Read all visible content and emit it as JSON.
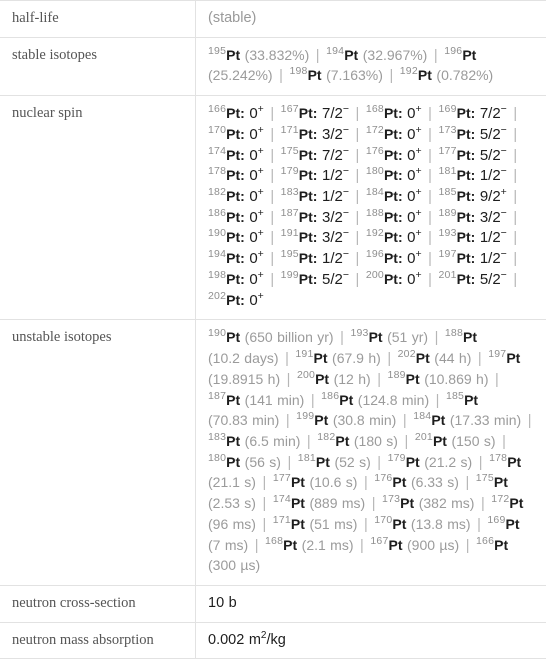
{
  "table": {
    "rows": [
      {
        "label": "half-life",
        "kind": "plain",
        "value": "(stable)"
      },
      {
        "label": "stable isotopes",
        "kind": "isotope_abundance"
      },
      {
        "label": "nuclear spin",
        "kind": "spin_list"
      },
      {
        "label": "unstable isotopes",
        "kind": "isotope_halflife"
      },
      {
        "label": "neutron cross-section",
        "kind": "plain_dark",
        "value": "10 b"
      },
      {
        "label": "neutron mass absorption",
        "kind": "units",
        "value_pre": "0.002 m",
        "value_sup": "2",
        "value_post": "/kg"
      }
    ]
  },
  "half_life": {
    "value": "(stable)"
  },
  "stable_isotopes": [
    {
      "mass": "195",
      "symbol": "Pt",
      "detail": "(33.832%)"
    },
    {
      "mass": "194",
      "symbol": "Pt",
      "detail": "(32.967%)"
    },
    {
      "mass": "196",
      "symbol": "Pt",
      "detail": "(25.242%)"
    },
    {
      "mass": "198",
      "symbol": "Pt",
      "detail": "(7.163%)"
    },
    {
      "mass": "192",
      "symbol": "Pt",
      "detail": "(0.782%)"
    }
  ],
  "nuclear_spin": [
    {
      "mass": "166",
      "symbol": "Pt",
      "spin": "0",
      "sup": "+"
    },
    {
      "mass": "167",
      "symbol": "Pt",
      "spin": "7/2",
      "sup": "−"
    },
    {
      "mass": "168",
      "symbol": "Pt",
      "spin": "0",
      "sup": "+"
    },
    {
      "mass": "169",
      "symbol": "Pt",
      "spin": "7/2",
      "sup": "−"
    },
    {
      "mass": "170",
      "symbol": "Pt",
      "spin": "0",
      "sup": "+"
    },
    {
      "mass": "171",
      "symbol": "Pt",
      "spin": "3/2",
      "sup": "−"
    },
    {
      "mass": "172",
      "symbol": "Pt",
      "spin": "0",
      "sup": "+"
    },
    {
      "mass": "173",
      "symbol": "Pt",
      "spin": "5/2",
      "sup": "−"
    },
    {
      "mass": "174",
      "symbol": "Pt",
      "spin": "0",
      "sup": "+"
    },
    {
      "mass": "175",
      "symbol": "Pt",
      "spin": "7/2",
      "sup": "−"
    },
    {
      "mass": "176",
      "symbol": "Pt",
      "spin": "0",
      "sup": "+"
    },
    {
      "mass": "177",
      "symbol": "Pt",
      "spin": "5/2",
      "sup": "−"
    },
    {
      "mass": "178",
      "symbol": "Pt",
      "spin": "0",
      "sup": "+"
    },
    {
      "mass": "179",
      "symbol": "Pt",
      "spin": "1/2",
      "sup": "−"
    },
    {
      "mass": "180",
      "symbol": "Pt",
      "spin": "0",
      "sup": "+"
    },
    {
      "mass": "181",
      "symbol": "Pt",
      "spin": "1/2",
      "sup": "−"
    },
    {
      "mass": "182",
      "symbol": "Pt",
      "spin": "0",
      "sup": "+"
    },
    {
      "mass": "183",
      "symbol": "Pt",
      "spin": "1/2",
      "sup": "−"
    },
    {
      "mass": "184",
      "symbol": "Pt",
      "spin": "0",
      "sup": "+"
    },
    {
      "mass": "185",
      "symbol": "Pt",
      "spin": "9/2",
      "sup": "+"
    },
    {
      "mass": "186",
      "symbol": "Pt",
      "spin": "0",
      "sup": "+"
    },
    {
      "mass": "187",
      "symbol": "Pt",
      "spin": "3/2",
      "sup": "−"
    },
    {
      "mass": "188",
      "symbol": "Pt",
      "spin": "0",
      "sup": "+"
    },
    {
      "mass": "189",
      "symbol": "Pt",
      "spin": "3/2",
      "sup": "−"
    },
    {
      "mass": "190",
      "symbol": "Pt",
      "spin": "0",
      "sup": "+"
    },
    {
      "mass": "191",
      "symbol": "Pt",
      "spin": "3/2",
      "sup": "−"
    },
    {
      "mass": "192",
      "symbol": "Pt",
      "spin": "0",
      "sup": "+"
    },
    {
      "mass": "193",
      "symbol": "Pt",
      "spin": "1/2",
      "sup": "−"
    },
    {
      "mass": "194",
      "symbol": "Pt",
      "spin": "0",
      "sup": "+"
    },
    {
      "mass": "195",
      "symbol": "Pt",
      "spin": "1/2",
      "sup": "−"
    },
    {
      "mass": "196",
      "symbol": "Pt",
      "spin": "0",
      "sup": "+"
    },
    {
      "mass": "197",
      "symbol": "Pt",
      "spin": "1/2",
      "sup": "−"
    },
    {
      "mass": "198",
      "symbol": "Pt",
      "spin": "0",
      "sup": "+"
    },
    {
      "mass": "199",
      "symbol": "Pt",
      "spin": "5/2",
      "sup": "−"
    },
    {
      "mass": "200",
      "symbol": "Pt",
      "spin": "0",
      "sup": "+"
    },
    {
      "mass": "201",
      "symbol": "Pt",
      "spin": "5/2",
      "sup": "−"
    },
    {
      "mass": "202",
      "symbol": "Pt",
      "spin": "0",
      "sup": "+"
    }
  ],
  "unstable_isotopes": [
    {
      "mass": "190",
      "symbol": "Pt",
      "detail": "(650 billion yr)"
    },
    {
      "mass": "193",
      "symbol": "Pt",
      "detail": "(51 yr)"
    },
    {
      "mass": "188",
      "symbol": "Pt",
      "detail": "(10.2 days)"
    },
    {
      "mass": "191",
      "symbol": "Pt",
      "detail": "(67.9 h)"
    },
    {
      "mass": "202",
      "symbol": "Pt",
      "detail": "(44 h)"
    },
    {
      "mass": "197",
      "symbol": "Pt",
      "detail": "(19.8915 h)"
    },
    {
      "mass": "200",
      "symbol": "Pt",
      "detail": "(12 h)"
    },
    {
      "mass": "189",
      "symbol": "Pt",
      "detail": "(10.869 h)"
    },
    {
      "mass": "187",
      "symbol": "Pt",
      "detail": "(141 min)"
    },
    {
      "mass": "186",
      "symbol": "Pt",
      "detail": "(124.8 min)"
    },
    {
      "mass": "185",
      "symbol": "Pt",
      "detail": "(70.83 min)"
    },
    {
      "mass": "199",
      "symbol": "Pt",
      "detail": "(30.8 min)"
    },
    {
      "mass": "184",
      "symbol": "Pt",
      "detail": "(17.33 min)"
    },
    {
      "mass": "183",
      "symbol": "Pt",
      "detail": "(6.5 min)"
    },
    {
      "mass": "182",
      "symbol": "Pt",
      "detail": "(180 s)"
    },
    {
      "mass": "201",
      "symbol": "Pt",
      "detail": "(150 s)"
    },
    {
      "mass": "180",
      "symbol": "Pt",
      "detail": "(56 s)"
    },
    {
      "mass": "181",
      "symbol": "Pt",
      "detail": "(52 s)"
    },
    {
      "mass": "179",
      "symbol": "Pt",
      "detail": "(21.2 s)"
    },
    {
      "mass": "178",
      "symbol": "Pt",
      "detail": "(21.1 s)"
    },
    {
      "mass": "177",
      "symbol": "Pt",
      "detail": "(10.6 s)"
    },
    {
      "mass": "176",
      "symbol": "Pt",
      "detail": "(6.33 s)"
    },
    {
      "mass": "175",
      "symbol": "Pt",
      "detail": "(2.53 s)"
    },
    {
      "mass": "174",
      "symbol": "Pt",
      "detail": "(889 ms)"
    },
    {
      "mass": "173",
      "symbol": "Pt",
      "detail": "(382 ms)"
    },
    {
      "mass": "172",
      "symbol": "Pt",
      "detail": "(96 ms)"
    },
    {
      "mass": "171",
      "symbol": "Pt",
      "detail": "(51 ms)"
    },
    {
      "mass": "170",
      "symbol": "Pt",
      "detail": "(13.8 ms)"
    },
    {
      "mass": "169",
      "symbol": "Pt",
      "detail": "(7 ms)"
    },
    {
      "mass": "168",
      "symbol": "Pt",
      "detail": "(2.1 ms)"
    },
    {
      "mass": "167",
      "symbol": "Pt",
      "detail": "(900 µs)"
    },
    {
      "mass": "166",
      "symbol": "Pt",
      "detail": "(300 µs)"
    }
  ],
  "neutron_cross_section": {
    "value": "10 b"
  },
  "neutron_mass_absorption": {
    "value_pre": "0.002 m",
    "value_sup": "2",
    "value_post": "/kg"
  },
  "separator": "|",
  "colors": {
    "border": "#e2e2e2",
    "label_text": "#555555",
    "value_text": "#1d1d1d",
    "muted_text": "#999999",
    "separator": "#b6b6b6"
  }
}
